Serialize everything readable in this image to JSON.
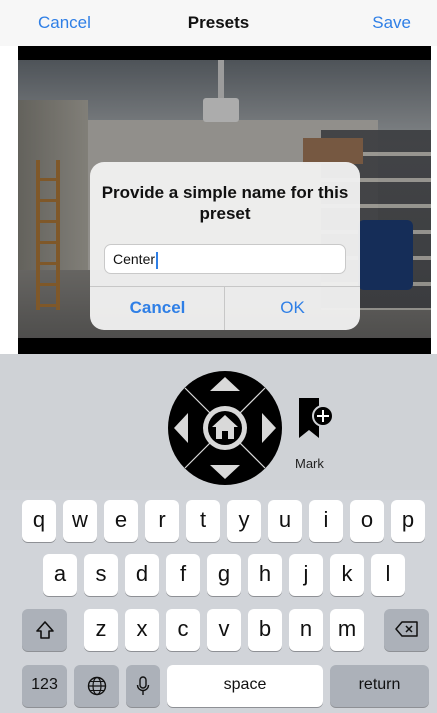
{
  "nav": {
    "cancel": "Cancel",
    "title": "Presets",
    "save": "Save"
  },
  "alert": {
    "message": "Provide a simple name for this preset",
    "input_value": "Center",
    "cancel": "Cancel",
    "ok": "OK"
  },
  "controls": {
    "mark_label": "Mark"
  },
  "keyboard": {
    "row1": [
      "q",
      "w",
      "e",
      "r",
      "t",
      "y",
      "u",
      "i",
      "o",
      "p"
    ],
    "row2": [
      "a",
      "s",
      "d",
      "f",
      "g",
      "h",
      "j",
      "k",
      "l"
    ],
    "row3": [
      "z",
      "x",
      "c",
      "v",
      "b",
      "n",
      "m"
    ],
    "numbers": "123",
    "space": "space",
    "return": "return"
  },
  "icons": [
    "shift-icon",
    "backspace-icon",
    "globe-icon",
    "microphone-icon",
    "home-icon",
    "arrow-up-icon",
    "arrow-down-icon",
    "arrow-left-icon",
    "arrow-right-icon",
    "bookmark-add-icon"
  ],
  "colors": {
    "accent": "#2f7fe6",
    "keyboard_bg": "#d1d4d9",
    "controls_bg": "#cfd2d6"
  }
}
